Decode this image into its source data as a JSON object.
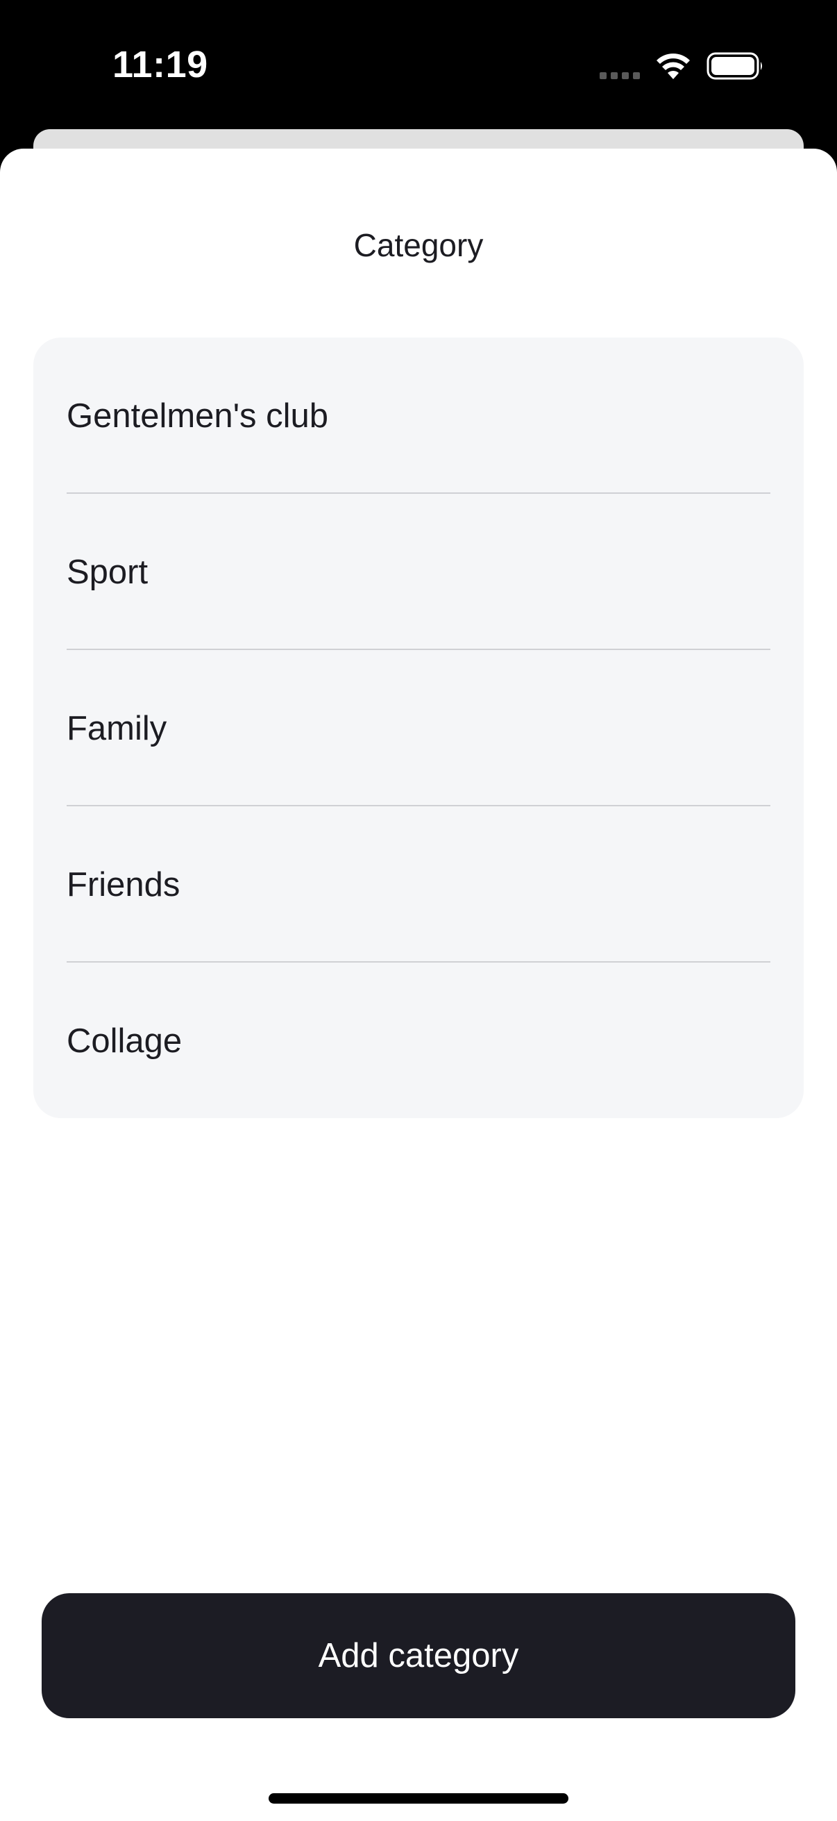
{
  "status_bar": {
    "time": "11:19",
    "icons": [
      "signal-dots-icon",
      "wifi-icon",
      "battery-icon"
    ]
  },
  "sheet": {
    "title": "Category"
  },
  "categories": [
    {
      "label": "Gentelmen's club"
    },
    {
      "label": "Sport"
    },
    {
      "label": "Family"
    },
    {
      "label": "Friends"
    },
    {
      "label": "Collage"
    }
  ],
  "actions": {
    "add_label": "Add category"
  },
  "colors": {
    "background": "#000000",
    "sheet": "#ffffff",
    "list_background": "#f5f6f8",
    "text": "#1c1c22",
    "button": "#1c1c24",
    "button_text": "#ffffff"
  }
}
